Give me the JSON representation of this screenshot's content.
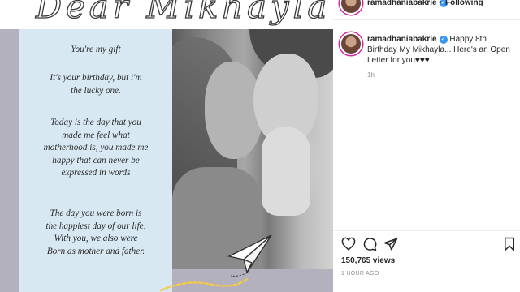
{
  "post_image": {
    "title": "Dear Mikhayla",
    "letter_paragraphs": [
      "You're my gift",
      "It's your birthday, but i'm\nthe lucky one.",
      "Today is the day that you\nmade me feel what\nmotherhood is, you made me\nhappy that can never be\nexpressed in words",
      "The day you were born is\nthe happiest day  of our life,\nWith you, we also were\nBorn as mother and father."
    ]
  },
  "header": {
    "username": "ramadhaniabakrie",
    "separator": "•",
    "follow_status": "Following"
  },
  "caption": {
    "username": "ramadhaniabakrie",
    "text": "Happy 8th Birthday My Mikhayla... Here's an Open Letter for you♥♥♥",
    "time_ago": "1h"
  },
  "actions": {
    "icons": [
      "heart-icon",
      "comment-icon",
      "share-icon",
      "bookmark-icon"
    ]
  },
  "stats": {
    "views": "150,765 views",
    "posted": "1 HOUR AGO"
  },
  "colors": {
    "verified_badge": "#3897f0",
    "letter_card": "#d8e8f3",
    "frame": "#b3b1bd"
  }
}
